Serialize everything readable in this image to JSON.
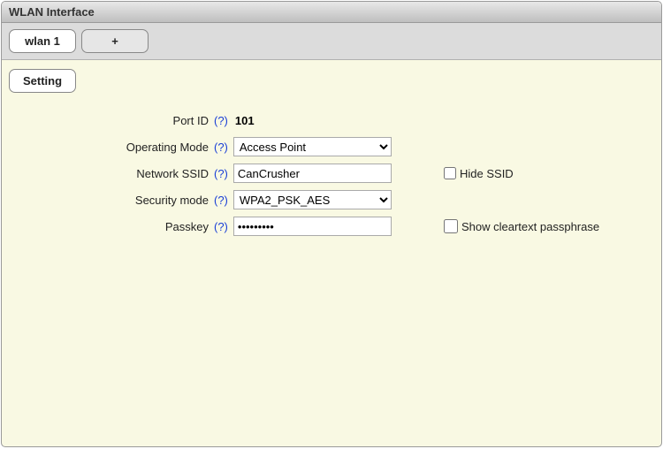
{
  "title": "WLAN Interface",
  "tabs": {
    "wlan1": "wlan 1",
    "add": "+"
  },
  "subtab": {
    "setting": "Setting"
  },
  "help_glyph": "(?)",
  "form": {
    "port_id": {
      "label": "Port ID",
      "value": "101"
    },
    "operating_mode": {
      "label": "Operating Mode",
      "value": "Access Point"
    },
    "network_ssid": {
      "label": "Network SSID",
      "value": "CanCrusher"
    },
    "security_mode": {
      "label": "Security mode",
      "value": "WPA2_PSK_AES"
    },
    "passkey": {
      "label": "Passkey",
      "value": "•••••••••"
    }
  },
  "extra": {
    "hide_ssid": "Hide SSID",
    "show_cleartext": "Show cleartext passphrase"
  }
}
